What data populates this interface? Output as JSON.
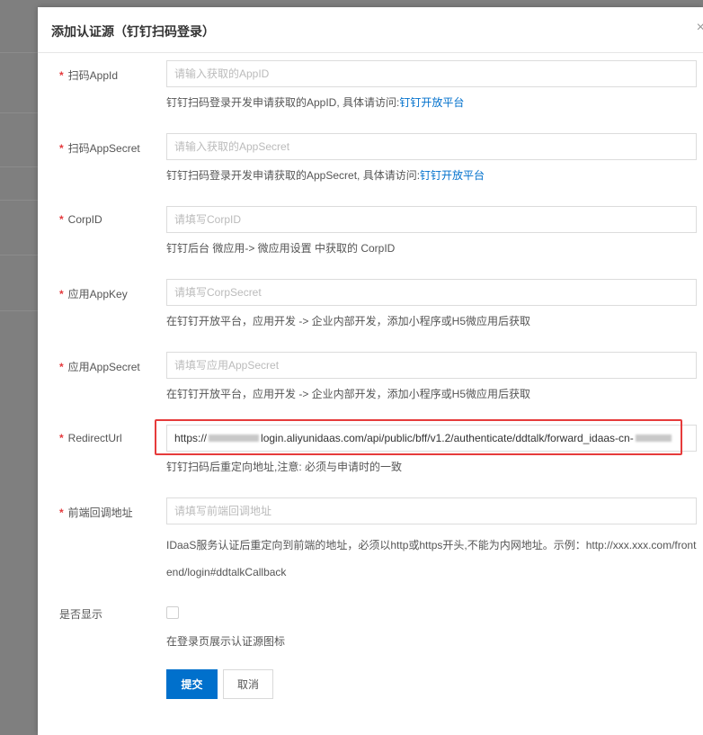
{
  "dialog": {
    "title": "添加认证源（钉钉扫码登录）",
    "close": "×"
  },
  "fields": {
    "appid": {
      "label": "扫码AppId",
      "placeholder": "请输入获取的AppID",
      "help": "钉钉扫码登录开发申请获取的AppID, 具体请访问:",
      "link": "钉钉开放平台"
    },
    "appsecret": {
      "label": "扫码AppSecret",
      "placeholder": "请输入获取的AppSecret",
      "help": "钉钉扫码登录开发申请获取的AppSecret, 具体请访问:",
      "link": "钉钉开放平台"
    },
    "corpid": {
      "label": "CorpID",
      "placeholder": "请填写CorpID",
      "help": "钉钉后台 微应用-> 微应用设置 中获取的 CorpID"
    },
    "appkey": {
      "label": "应用AppKey",
      "placeholder": "请填写CorpSecret",
      "help": "在钉钉开放平台，应用开发 -> 企业内部开发，添加小程序或H5微应用后获取"
    },
    "app_secret": {
      "label": "应用AppSecret",
      "placeholder": "请填写应用AppSecret",
      "help": "在钉钉开放平台，应用开发 -> 企业内部开发，添加小程序或H5微应用后获取"
    },
    "redirect": {
      "label": "RedirectUrl",
      "value_prefix": "https://",
      "value_main": "login.aliyunidaas.com/api/public/bff/v1.2/authenticate/ddtalk/forward_idaas-cn-",
      "help": "钉钉扫码后重定向地址,注意: 必须与申请时的一致"
    },
    "frontend": {
      "label": "前端回调地址",
      "placeholder": "请填写前端回调地址",
      "help_line1": "IDaaS服务认证后重定向到前端的地址，必须以http或https开头,不能为内网地址。示例：http://xxx.xxx.com/front",
      "help_line2": "end/login#ddtalkCallback"
    },
    "display": {
      "label": "是否显示",
      "help": "在登录页展示认证源图标",
      "checked": false
    }
  },
  "required_mark": "*",
  "buttons": {
    "submit": "提交",
    "cancel": "取消"
  },
  "colors": {
    "primary": "#0070cc",
    "required": "#e4393c",
    "highlight_frame": "#e63b3b"
  }
}
